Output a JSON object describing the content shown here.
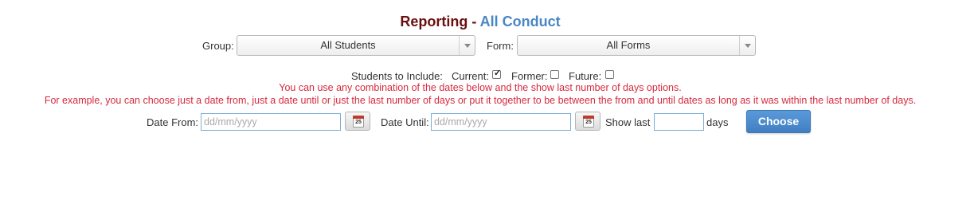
{
  "header": {
    "title_prefix": "Reporting - ",
    "title_highlight": "All Conduct"
  },
  "filters": {
    "group_label": "Group:",
    "group_value": "All Students",
    "form_label": "Form:",
    "form_value": "All Forms"
  },
  "students": {
    "include_label": "Students to Include:",
    "current_label": "Current:",
    "current_checked": true,
    "former_label": "Former:",
    "former_checked": false,
    "future_label": "Future:",
    "future_checked": false
  },
  "notes": {
    "line1": "You can use any combination of the dates below and the show last number of days options.",
    "line2": "For example, you can choose just a date from, just a date until or just the last number of days or put it together to be between the from and until dates as long as it was within the last number of days."
  },
  "dates": {
    "from_label": "Date From:",
    "from_placeholder": "dd/mm/yyyy",
    "until_label": "Date Until:",
    "until_placeholder": "dd/mm/yyyy",
    "calendar_day": "25",
    "show_last_label": "Show last",
    "days_label": "days"
  },
  "actions": {
    "choose_label": "Choose"
  },
  "colors": {
    "title_dark": "#6b0e0e",
    "title_accent": "#4a86c5",
    "note_red": "#d6293e",
    "button_blue": "#4a8ccd"
  }
}
